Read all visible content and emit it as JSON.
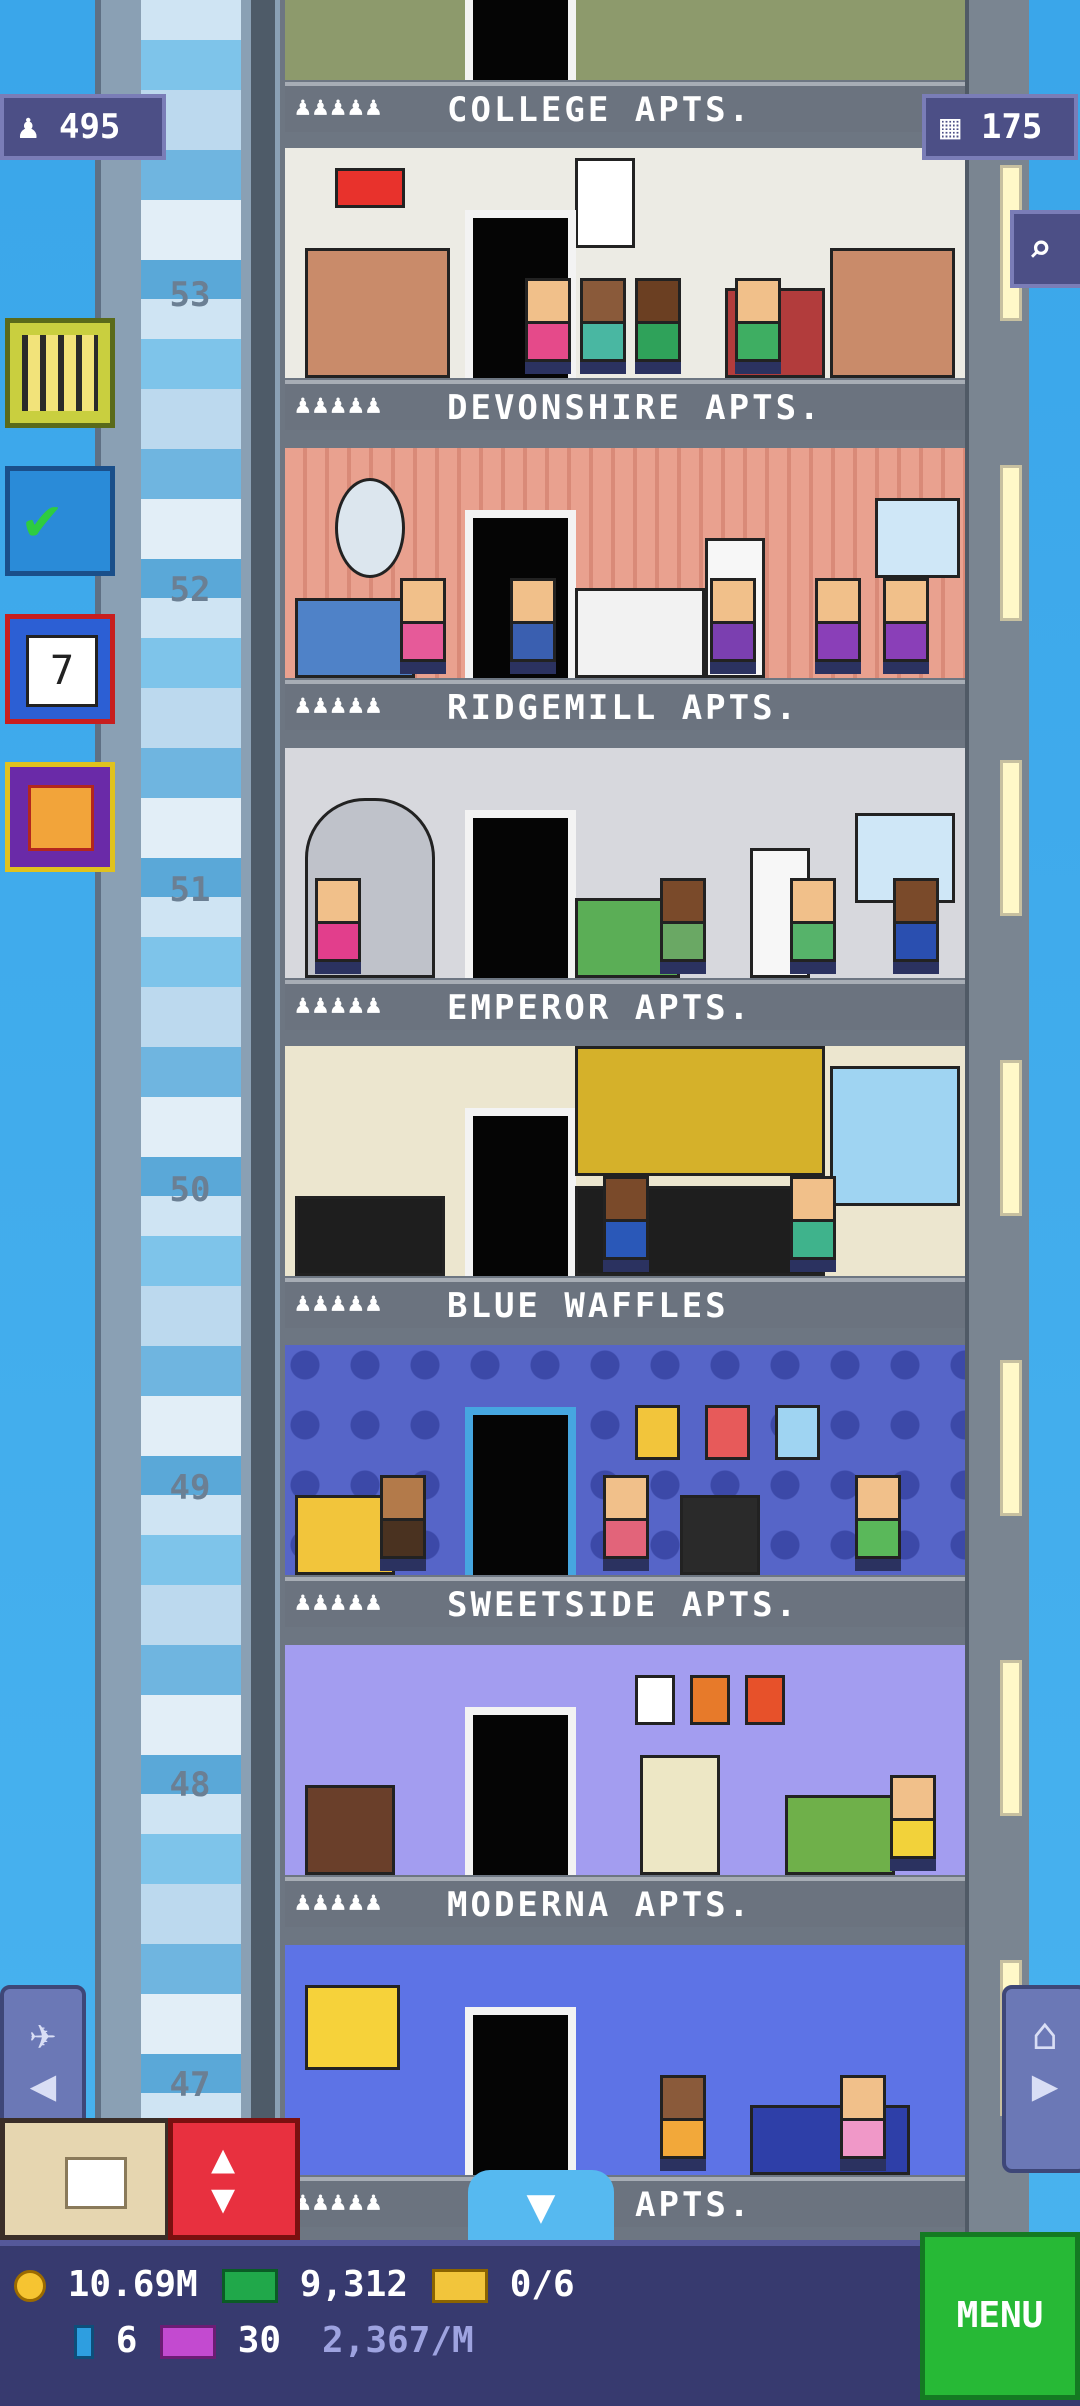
{
  "hud": {
    "population": "495",
    "floors_count": "175"
  },
  "floors": [
    {
      "number": "53",
      "name": "COLLEGE APTS.",
      "people": "♟♟♟♟♟"
    },
    {
      "number": "53",
      "name": "DEVONSHIRE APTS.",
      "people": "♟♟♟♟♟"
    },
    {
      "number": "52",
      "name": "RIDGEMILL APTS.",
      "people": "♟♟♟♟♟"
    },
    {
      "number": "51",
      "name": "EMPEROR APTS.",
      "people": "♟♟♟♟♟"
    },
    {
      "number": "50",
      "name": "BLUE WAFFLES",
      "people": "♟♟♟♟♟"
    },
    {
      "number": "49",
      "name": "SWEETSIDE APTS.",
      "people": "♟♟♟♟♟"
    },
    {
      "number": "48",
      "name": "MODERNA APTS.",
      "people": "♟♟♟♟♟"
    },
    {
      "number": "47",
      "name": "APTS.",
      "people": "♟♟♟♟♟"
    }
  ],
  "floor_numbers": [
    "53",
    "52",
    "51",
    "50",
    "49",
    "48",
    "47"
  ],
  "icons": {
    "population": "person-icon",
    "floors": "building-icon",
    "search": "magnifier-icon",
    "build": "building-grid-icon",
    "missions": "checklist-icon",
    "calendar": "calendar-icon",
    "gift": "gift-icon"
  },
  "bottom": {
    "coins": "10.69M",
    "bux": "9,312",
    "tickets": "0/6",
    "gems": "6",
    "vip": "30",
    "income": "2,367/M",
    "menu_label": "MENU"
  },
  "colors": {
    "sky": "#3fa7e8",
    "menu": "#27b936",
    "bottom_bar": "#373a6f"
  }
}
